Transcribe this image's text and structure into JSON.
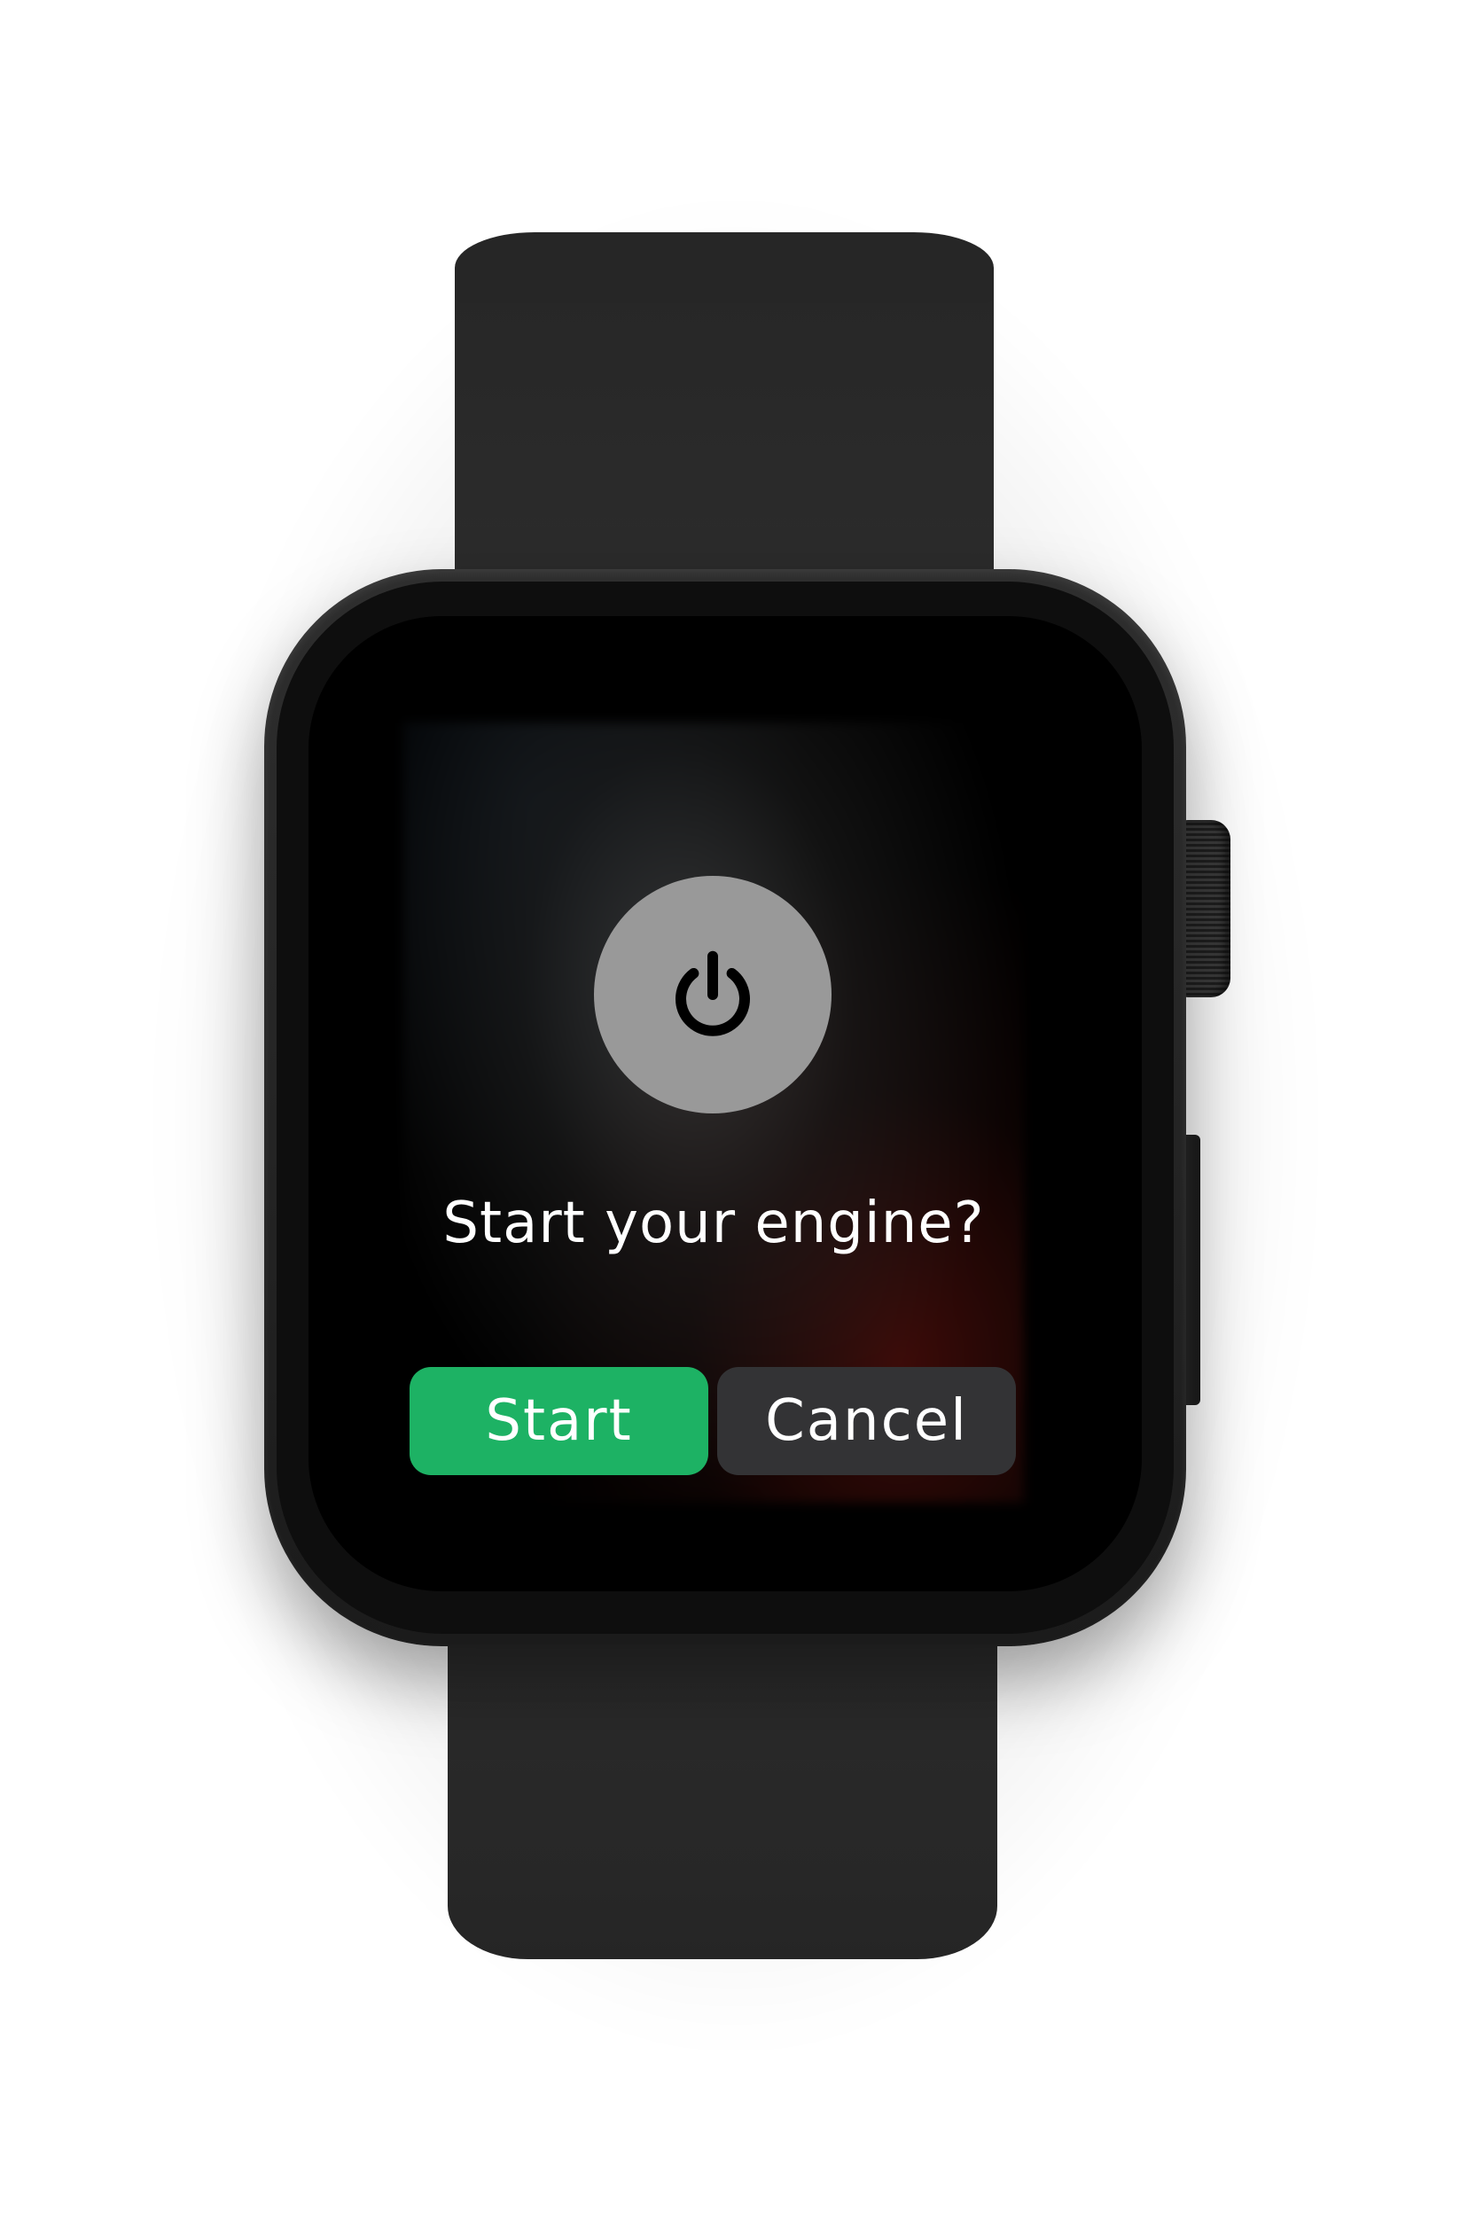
{
  "alert": {
    "icon": "power-icon",
    "message": "Start your engine?",
    "primary_label": "Start",
    "secondary_label": "Cancel"
  },
  "colors": {
    "start_button": "#1db264",
    "cancel_button": "#333335",
    "icon_circle": "#999999"
  }
}
